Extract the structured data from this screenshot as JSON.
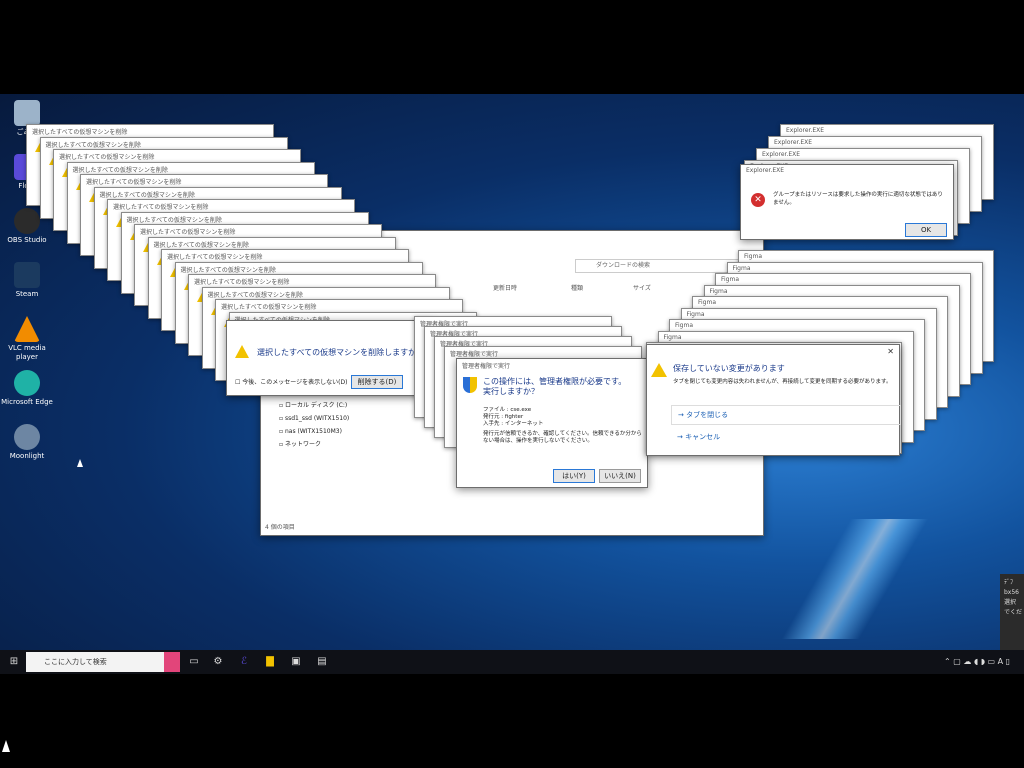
{
  "desktop_icons": [
    {
      "label": "ごみ箱",
      "icon": "recycle-bin-icon",
      "color": "#9cb3c9"
    },
    {
      "label": "Flo…",
      "icon": "app-icon",
      "color": "#5a4ad9"
    },
    {
      "label": "OBS Studio",
      "icon": "obs-icon",
      "color": "#2b2b2b"
    },
    {
      "label": "Steam",
      "icon": "steam-icon",
      "color": "#1b3a5f"
    },
    {
      "label": "VLC media player",
      "icon": "vlc-icon",
      "color": "#f28c00"
    },
    {
      "label": "Microsoft Edge",
      "icon": "edge-icon",
      "color": "#1fb2a6"
    },
    {
      "label": "Moonlight",
      "icon": "moonlight-icon",
      "color": "#6d86a3"
    }
  ],
  "vm_dialog": {
    "stack_title": "選択したすべての仮想マシンを削除",
    "message": "選択したすべての仮想マシンを削除しますか?",
    "checkbox": "今後、このメッセージを表示しない(D)",
    "delete_button": "削除する(D)"
  },
  "explorer": {
    "search_placeholder": "ダウンロードの検索",
    "columns": [
      "更新日時",
      "種類",
      "サイズ"
    ],
    "tree": [
      "ローカル ディスク (C:)",
      "ssd1_ssd (WITX1510)",
      "nas (WITX1510M3)",
      "ネットワーク"
    ],
    "status": "4 個の項目"
  },
  "uac": {
    "stack_title": "管理者権限で実行",
    "heading": "この操作には、管理者権限が必要です。実行しますか？",
    "file": "ファイル : cse.exe",
    "publisher": "発行元 : fighter",
    "source": "入手先 : インターネット",
    "note": "発行元が信頼できるか、確認してください。信頼できるか分からない場合は、操作を実行しないでください。",
    "yes": "はい(Y)",
    "no": "いいえ(N)"
  },
  "explorer_error": {
    "title": "Explorer.EXE",
    "message": "グループまたはリソースは要求した操作の実行に適切な状態ではありません。",
    "ok": "OK"
  },
  "unsaved": {
    "stack_title": "Figma",
    "heading": "保存していない変更があります",
    "body": "タブを閉じても変更内容は失われませんが、再接続して変更を同期する必要があります。",
    "close_tab": "→ タブを閉じる",
    "cancel": "→ キャンセル"
  },
  "taskbar": {
    "search_placeholder": "ここに入力して検索",
    "ime": "A"
  },
  "notification": {
    "line1": "ﾃﾞﾌ",
    "line2": "bx56",
    "line3": "選択",
    "line4": "でくだ"
  },
  "colors": {
    "accent": "#2a78d6",
    "warning": "#f2c200",
    "error": "#d32f2f"
  }
}
